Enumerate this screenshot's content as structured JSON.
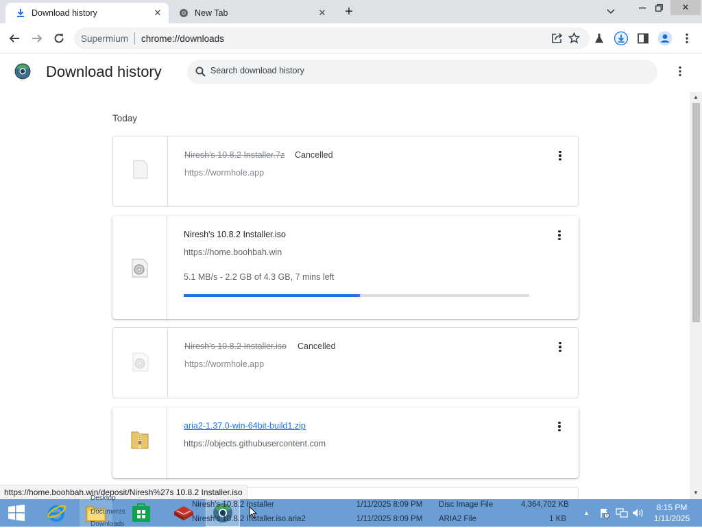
{
  "browser": {
    "tabs": [
      {
        "label": "Download history",
        "active": true
      },
      {
        "label": "New Tab",
        "active": false
      }
    ],
    "omnibox": {
      "brand": "Supermium",
      "url": "chrome://downloads"
    }
  },
  "page": {
    "title": "Download history",
    "search_placeholder": "Search download history"
  },
  "downloads": {
    "section": "Today",
    "items": [
      {
        "filename": "Niresh's 10.8.2 Installer.7z",
        "status": "Cancelled",
        "url": "https://wormhole.app",
        "state": "cancelled",
        "icon": "blank-file-icon"
      },
      {
        "filename": "Niresh's 10.8.2 Installer.iso",
        "url": "https://home.boohbah.win",
        "progress_text": "5.1 MB/s - 2.2 GB of 4.3 GB, 7 mins left",
        "progress": 0.51,
        "state": "in-progress",
        "icon": "disc-image-icon"
      },
      {
        "filename": "Niresh's 10.8.2 Installer.iso",
        "status": "Cancelled",
        "url": "https://wormhole.app",
        "state": "cancelled",
        "icon": "disc-image-icon"
      },
      {
        "filename": "aria2-1.37.0-win-64bit-build1.zip",
        "url": "https://objects.githubusercontent.com",
        "state": "complete",
        "icon": "zip-folder-icon"
      }
    ]
  },
  "status_bar": {
    "url": "https://home.boohbah.win/deposit/Niresh%27s 10.8.2 Installer.iso"
  },
  "taskbar": {
    "explorer_rows": [
      {
        "name": "Niresh's 10.8.2 Installer",
        "date": "1/11/2025 8:09 PM",
        "type": "Disc Image File",
        "size": "4,364,702 KB"
      },
      {
        "name": "Niresh's 10.8.2 Installer.iso.aria2",
        "date": "1/11/2025 8:09 PM",
        "type": "ARIA2 File",
        "size": "1 KB"
      }
    ],
    "explorer_folder_labels": [
      "Desktop",
      "Documents",
      "Downloads"
    ],
    "clock": {
      "time": "8:15 PM",
      "date": "1/11/2025"
    }
  },
  "colors": {
    "accent": "#1a73e8",
    "tabstrip": "#dee1e6",
    "taskbar": "#6b9ed4"
  }
}
